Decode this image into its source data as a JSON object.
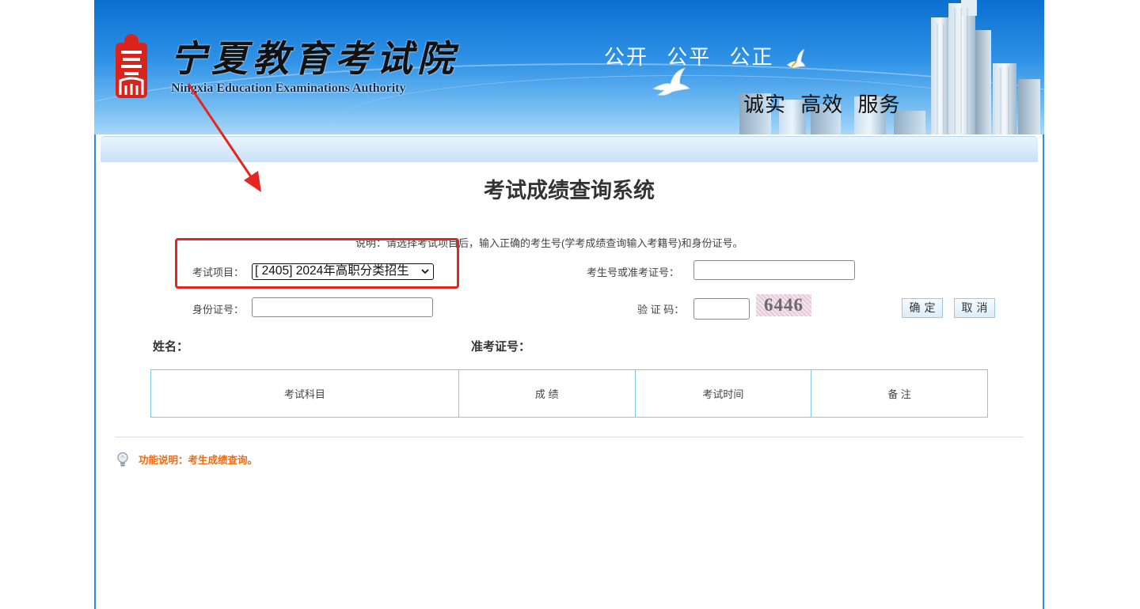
{
  "banner": {
    "org_name_cn": "宁夏教育考试院",
    "org_name_en": "Ningxia Education Examinations Authority",
    "slogan_top": "公开 公平 公正",
    "slogan_bottom": "诚实 高效 服务"
  },
  "page": {
    "title": "考试成绩查询系统",
    "note": "说明：请选择考试项目后，输入正确的考生号(学考成绩查询输入考籍号)和身份证号。"
  },
  "form": {
    "exam_item_label": "考试项目：",
    "exam_item_selected": "[ 2405] 2024年高职分类招生",
    "candidate_no_label": "考生号或准考证号：",
    "candidate_no_value": "",
    "id_no_label": "身份证号：",
    "id_no_value": "",
    "captcha_label": "验 证 码：",
    "captcha_value": "",
    "captcha_code": "6446",
    "confirm_label": "确定",
    "cancel_label": "取消"
  },
  "result": {
    "name_label": "姓名：",
    "ticket_label": "准考证号：",
    "columns": [
      "考试科目",
      "成 绩",
      "考试时间",
      "备 注"
    ]
  },
  "footer": {
    "tip": "功能说明：考生成绩查询。"
  },
  "colors": {
    "banner_blue": "#2f92e6",
    "frame_border": "#2a8ee0",
    "table_border": "#7fcce6",
    "tip_orange": "#f06a10",
    "annotation_red": "#e5261f"
  }
}
